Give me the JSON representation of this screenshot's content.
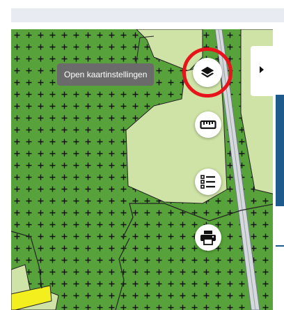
{
  "tooltip": {
    "text": "Open kaartinstellingen"
  },
  "controls": {
    "layers": {
      "icon": "layers-icon"
    },
    "measure": {
      "icon": "ruler-icon"
    },
    "legend": {
      "icon": "legend-list-icon"
    },
    "print": {
      "icon": "printer-icon"
    }
  },
  "side_panel": {
    "toggle_icon": "chevron-right-icon"
  },
  "highlight": {
    "color": "#e8141b"
  },
  "map": {
    "colors": {
      "forest": "#57a23a",
      "meadow": "#cfe3a6",
      "road": "#cfd3d6",
      "yellow_zone": "#f3ef1e",
      "cross": "#111111"
    }
  }
}
